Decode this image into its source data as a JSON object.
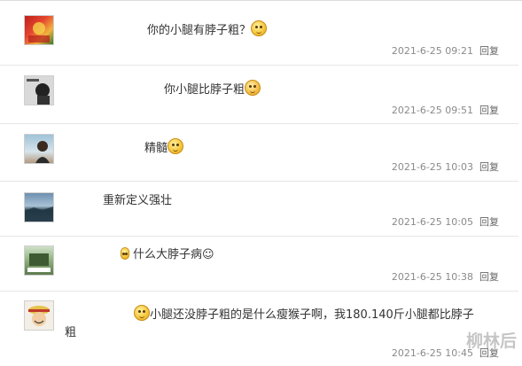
{
  "comments": [
    {
      "text": "你的小腿有脖子粗？",
      "emoji": "sweat-smile-emoji",
      "timestamp": "2021-6-25 09:21",
      "reply": "回复"
    },
    {
      "text": "你小腿比脖子粗",
      "emoji": "hand-over-mouth-emoji",
      "timestamp": "2021-6-25 09:51",
      "reply": "回复"
    },
    {
      "text": "精髓",
      "emoji": "grin-emoji",
      "timestamp": "2021-6-25 10:03",
      "reply": "回复"
    },
    {
      "text": "重新定义强壮",
      "emoji": "",
      "timestamp": "2021-6-25 10:05",
      "reply": "回复"
    },
    {
      "text": "什么大脖子病☺",
      "emoji": "",
      "timestamp": "2021-6-25 10:38",
      "reply": "回复"
    },
    {
      "text": "小腿还没脖子粗的是什么瘦猴子啊，我180.140斤小腿都比脖子",
      "text_line2": "粗",
      "emoji": "sweat-smile-emoji",
      "timestamp": "2021-6-25 10:45",
      "reply": "回复"
    }
  ],
  "watermark": "柳林后",
  "colors": {
    "timestamp": "#8a8a8a",
    "text": "#333333",
    "divider": "#e6e6e6"
  }
}
